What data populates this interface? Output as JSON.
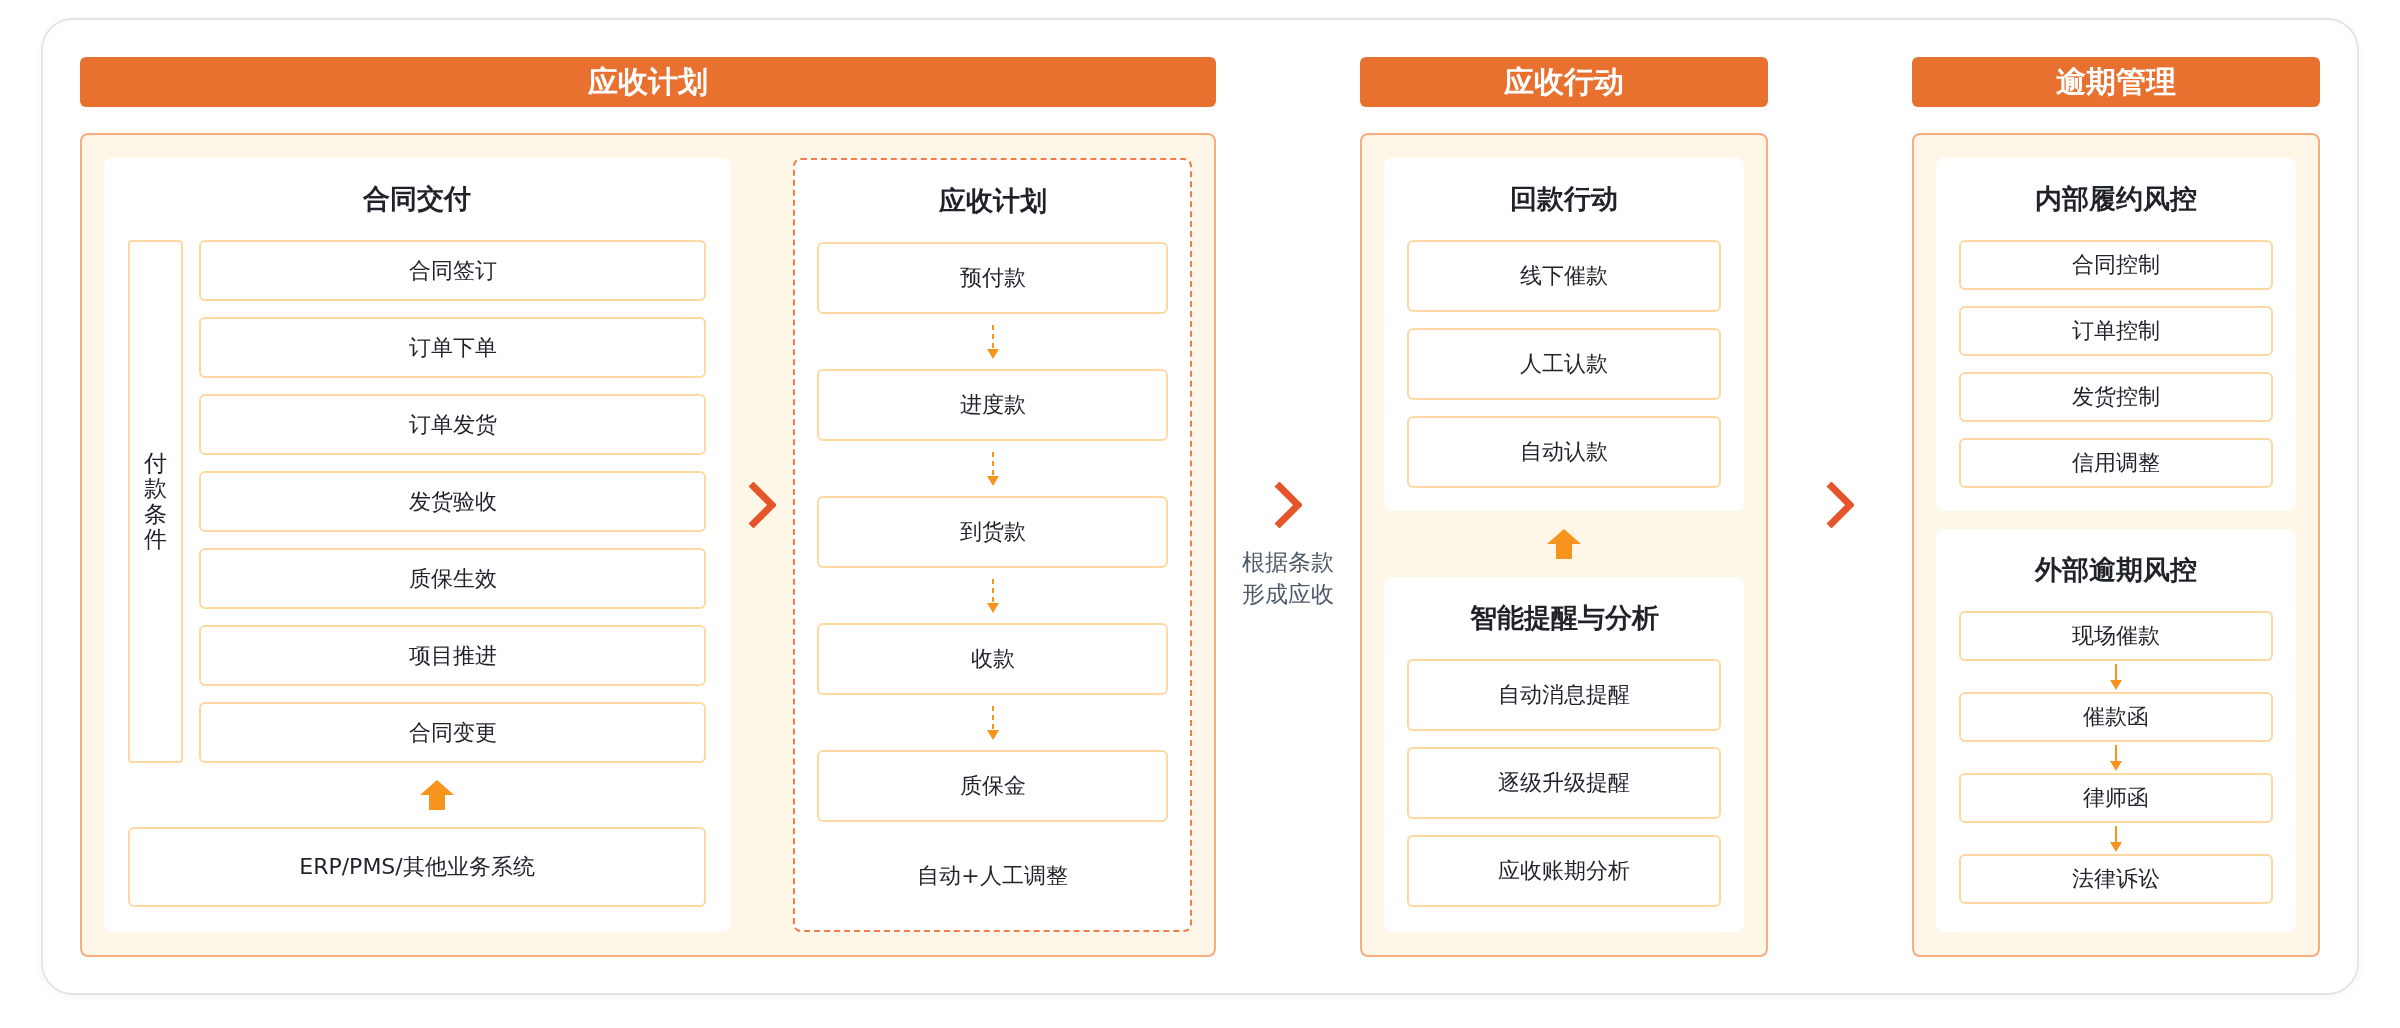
{
  "sections": [
    {
      "title": "应收计划",
      "kind": "split",
      "panels": [
        {
          "kind": "grouped",
          "title": "合同交付",
          "side_label": "付款条件",
          "items": [
            "合同签订",
            "订单下单",
            "订单发货",
            "发货验收",
            "质保生效",
            "项目推进",
            "合同变更"
          ],
          "source": "ERP/PMS/其他业务系统"
        },
        {
          "kind": "flow",
          "title": "应收计划",
          "dashed": true,
          "items": [
            "预付款",
            "进度款",
            "到货款",
            "收款",
            "质保金"
          ],
          "footer": "自动+人工调整"
        }
      ]
    },
    {
      "title": "应收行动",
      "kind": "stacked-linked",
      "panels": [
        {
          "kind": "list",
          "title": "回款行动",
          "items": [
            "线下催款",
            "人工认款",
            "自动认款"
          ]
        },
        {
          "kind": "list",
          "title": "智能提醒与分析",
          "items": [
            "自动消息提醒",
            "逐级升级提醒",
            "应收账期分析"
          ]
        }
      ]
    },
    {
      "title": "逾期管理",
      "kind": "stacked",
      "panels": [
        {
          "kind": "list",
          "title": "内部履约风控",
          "items": [
            "合同控制",
            "订单控制",
            "发货控制",
            "信用调整"
          ]
        },
        {
          "kind": "flow",
          "title": "外部逾期风控",
          "dashed": false,
          "items": [
            "现场催款",
            "催款函",
            "律师函",
            "法律诉讼"
          ]
        }
      ]
    }
  ],
  "connectors": [
    {
      "kind": "chevron",
      "caption": "根据条款形成应收"
    },
    {
      "kind": "chevron"
    }
  ]
}
